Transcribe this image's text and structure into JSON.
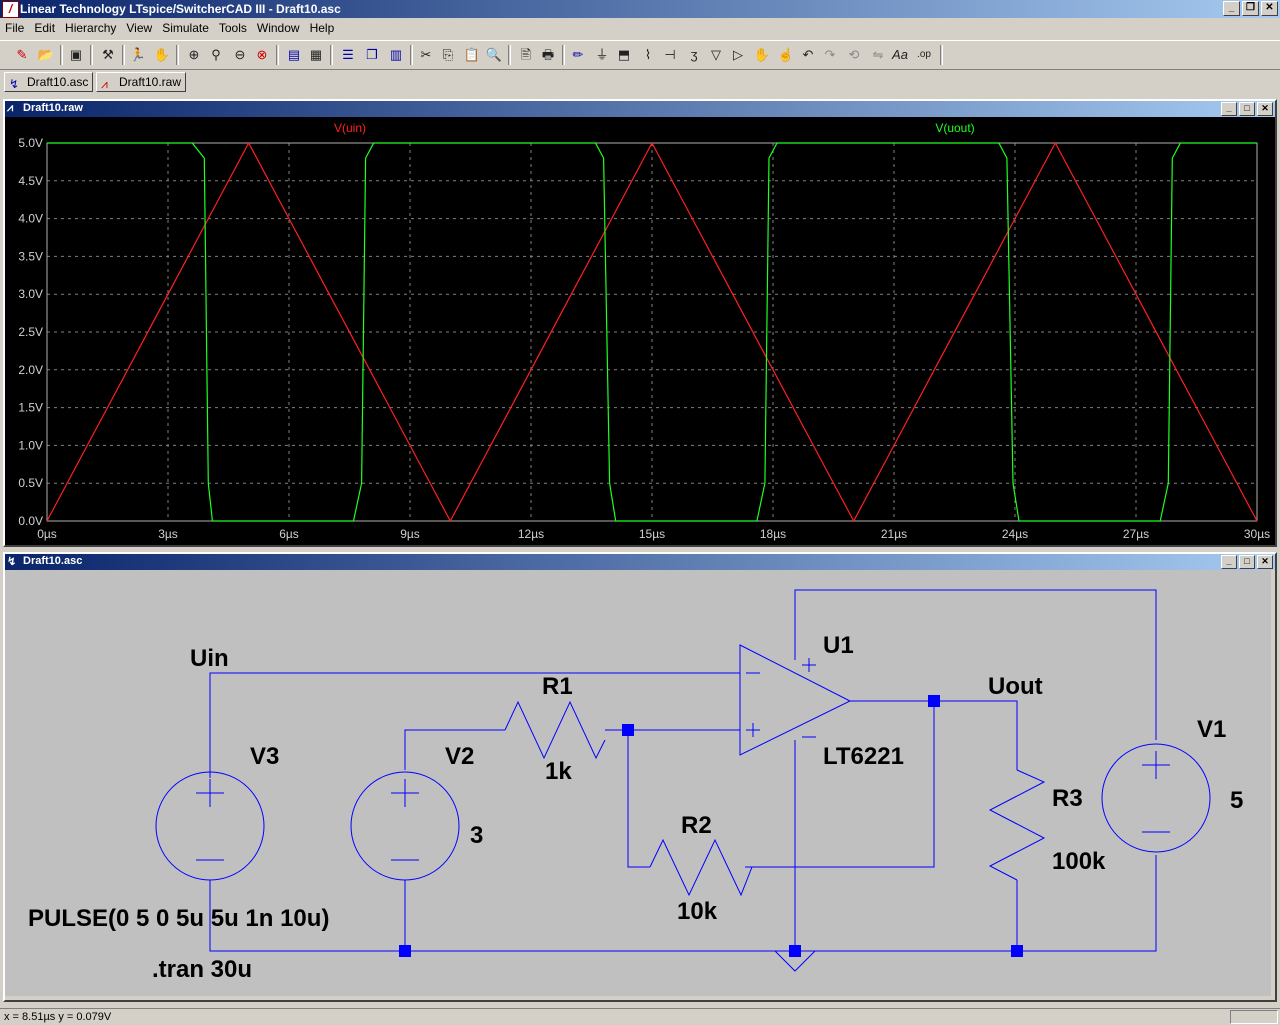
{
  "app": {
    "title": "Linear Technology LTspice/SwitcherCAD III - Draft10.asc"
  },
  "menu": [
    "File",
    "Edit",
    "Hierarchy",
    "View",
    "Simulate",
    "Tools",
    "Window",
    "Help"
  ],
  "tabs": [
    {
      "label": "Draft10.asc",
      "icon": "schematic-icon"
    },
    {
      "label": "Draft10.raw",
      "icon": "waveform-icon"
    }
  ],
  "plot_window": {
    "title": "Draft10.raw"
  },
  "schematic_window": {
    "title": "Draft10.asc"
  },
  "chart_data": {
    "type": "line",
    "x": [
      0,
      1,
      2,
      3,
      4,
      5,
      6,
      7,
      8,
      9,
      10,
      11,
      12,
      13,
      14,
      15,
      16,
      17,
      18,
      19,
      20,
      21,
      22,
      23,
      24,
      25,
      26,
      27,
      28,
      29,
      30
    ],
    "x_unit": "µs",
    "xticks": [
      "0µs",
      "3µs",
      "6µs",
      "9µs",
      "12µs",
      "15µs",
      "18µs",
      "21µs",
      "24µs",
      "27µs",
      "30µs"
    ],
    "yticks": [
      "0.0V",
      "0.5V",
      "1.0V",
      "1.5V",
      "2.0V",
      "2.5V",
      "3.0V",
      "3.5V",
      "4.0V",
      "4.5V",
      "5.0V"
    ],
    "xlim": [
      0,
      30
    ],
    "ylim": [
      0,
      5
    ],
    "grid": true,
    "series": [
      {
        "name": "V(uin)",
        "color": "#ff2020",
        "values": [
          0,
          1,
          2,
          3,
          4,
          5,
          4,
          3,
          2,
          1,
          0,
          1,
          2,
          3,
          4,
          5,
          4,
          3,
          2,
          1,
          0,
          1,
          2,
          3,
          4,
          5,
          4,
          3,
          2,
          1,
          0
        ]
      },
      {
        "name": "V(uout)",
        "color": "#20ff20",
        "points": [
          [
            0,
            5
          ],
          [
            3.6,
            5
          ],
          [
            3.9,
            4.8
          ],
          [
            4.0,
            0.5
          ],
          [
            4.1,
            0
          ],
          [
            7.6,
            0
          ],
          [
            7.8,
            0.5
          ],
          [
            7.9,
            4.8
          ],
          [
            8.1,
            5
          ],
          [
            13.6,
            5
          ],
          [
            13.8,
            4.8
          ],
          [
            13.95,
            0.5
          ],
          [
            14.1,
            0
          ],
          [
            17.6,
            0
          ],
          [
            17.8,
            0.5
          ],
          [
            17.9,
            4.8
          ],
          [
            18.1,
            5
          ],
          [
            23.6,
            5
          ],
          [
            23.8,
            4.8
          ],
          [
            23.95,
            0.5
          ],
          [
            24.1,
            0
          ],
          [
            27.6,
            0
          ],
          [
            27.8,
            0.5
          ],
          [
            27.9,
            4.8
          ],
          [
            28.1,
            5
          ],
          [
            30,
            5
          ]
        ]
      }
    ]
  },
  "schematic": {
    "labels": {
      "uin": "Uin",
      "uout": "Uout",
      "v1": "V1",
      "v1_val": "5",
      "v2": "V2",
      "v2_val": "3",
      "v3": "V3",
      "r1": "R1",
      "r1_val": "1k",
      "r2": "R2",
      "r2_val": "10k",
      "r3": "R3",
      "r3_val": "100k",
      "u1": "U1",
      "u1_val": "LT6221",
      "pulse": "PULSE(0 5 0 5u 5u 1n 10u)",
      "tran": ".tran 30u"
    }
  },
  "status": {
    "cursor": "x = 8.51µs    y = 0.079V"
  }
}
